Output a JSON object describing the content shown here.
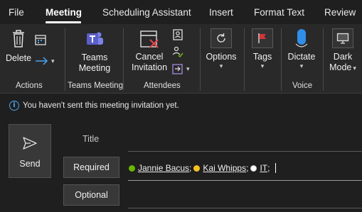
{
  "tabs": [
    "File",
    "Meeting",
    "Scheduling Assistant",
    "Insert",
    "Format Text",
    "Review"
  ],
  "active_tab": "Meeting",
  "ribbon": {
    "delete_label": "Delete",
    "teams_label_1": "Teams",
    "teams_label_2": "Meeting",
    "cancel_label_1": "Cancel",
    "cancel_label_2": "Invitation",
    "options_label": "Options",
    "tags_label": "Tags",
    "dictate_label": "Dictate",
    "darkmode_label_1": "Dark",
    "darkmode_label_2": "Mode",
    "groups": [
      "Actions",
      "Teams Meeting",
      "Attendees",
      "Voice"
    ]
  },
  "info_bar": {
    "message": "You haven't sent this meeting invitation yet."
  },
  "form": {
    "send_label": "Send",
    "title_label": "Title",
    "required_label": "Required",
    "optional_label": "Optional",
    "required_attendees": [
      {
        "name": "Jannie Bacus",
        "presence": "available"
      },
      {
        "name": "Kai Whipps",
        "presence": "away"
      },
      {
        "name": "IT",
        "presence": "unknown"
      }
    ]
  },
  "colors": {
    "background": "#1f1f1f",
    "ribbon": "#292929",
    "teams_purple": "#5b5fc7",
    "tags_red": "#d13438",
    "dictate_blue": "#2f8fe8",
    "info_blue": "#4aa3f0",
    "presence_available": "#6bb700",
    "presence_away": "#f8c21e"
  }
}
